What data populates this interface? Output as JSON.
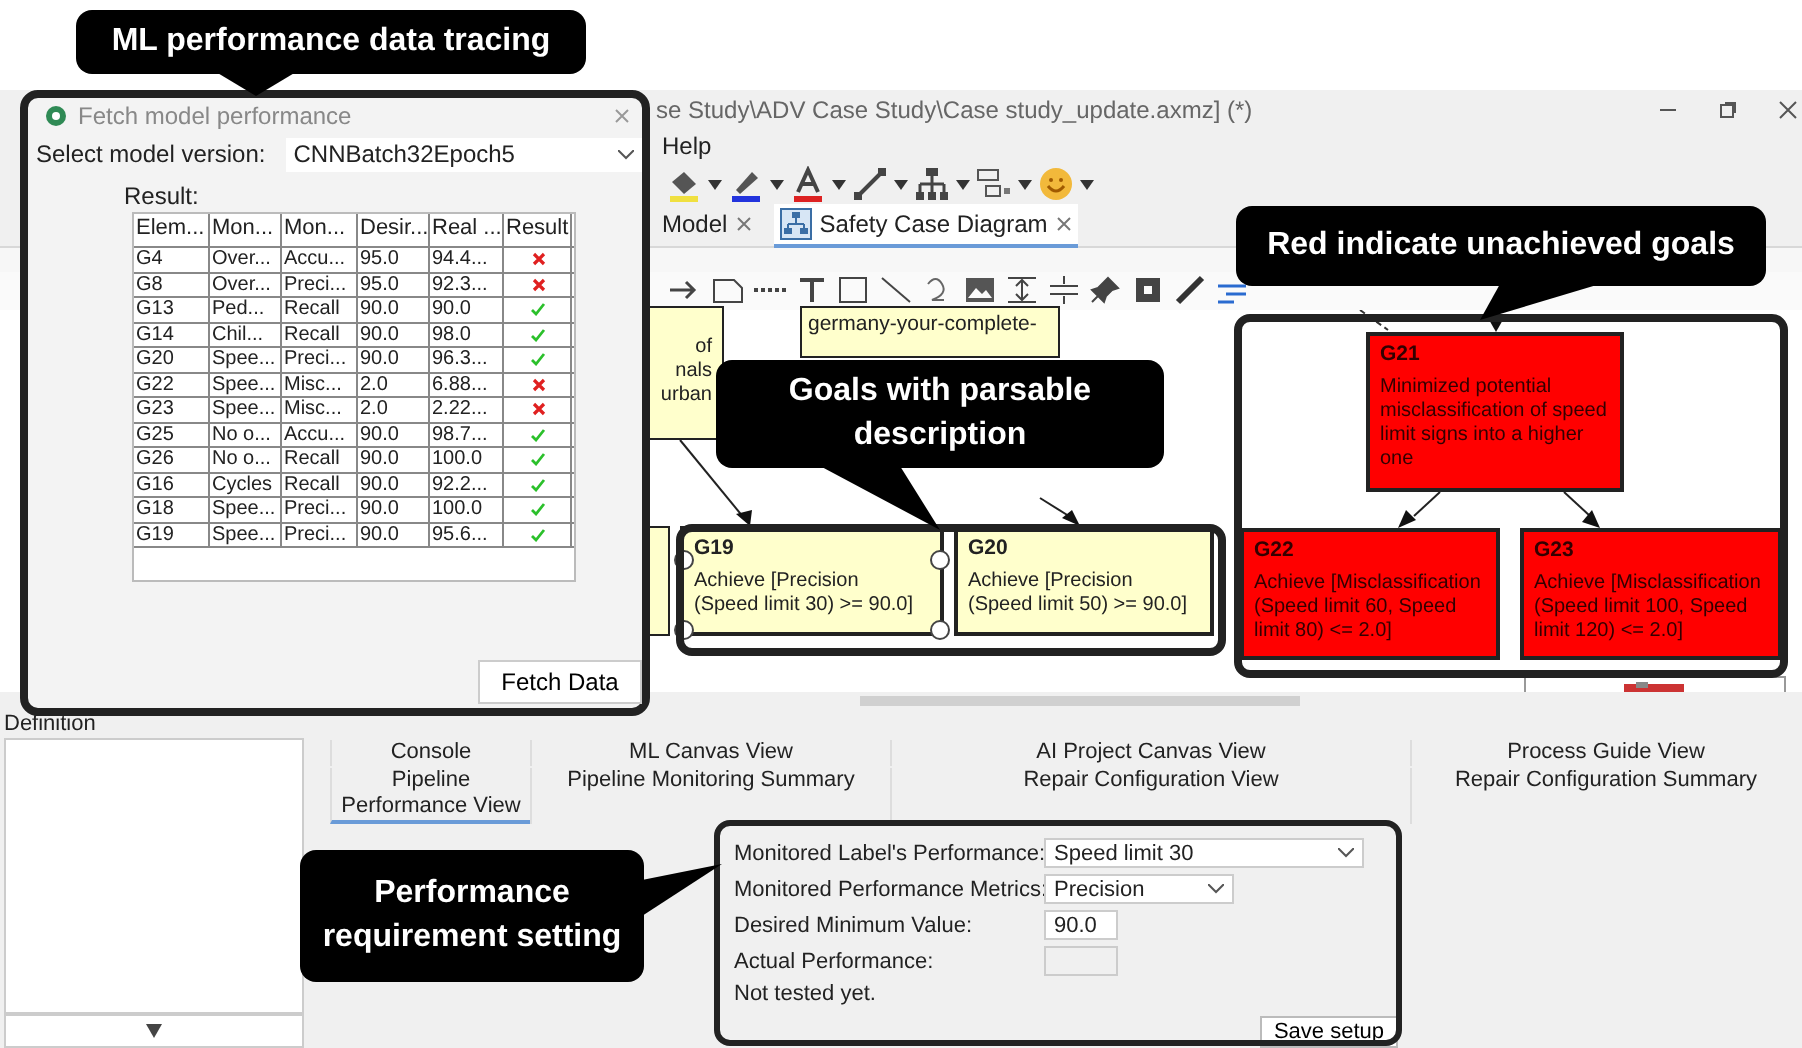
{
  "window": {
    "title": "se Study\\ADV Case Study\\Case study_update.axmz] (*)",
    "menu": [
      "Help"
    ]
  },
  "editor_tabs": [
    {
      "label": "Model",
      "selected": false
    },
    {
      "label": "Safety Case Diagram",
      "selected": true
    }
  ],
  "diagram_nodes": [
    {
      "kind": "fragment",
      "lines": [
        "of",
        "nals",
        "urban"
      ],
      "achieved": true,
      "selected": false
    },
    {
      "kind": "note",
      "lines": [
        "germany-your-complete-"
      ],
      "achieved": true,
      "selected": false
    },
    {
      "kind": "fragment",
      "achieved": true,
      "selected": false
    },
    {
      "kind": "goal",
      "title": "G19",
      "lines": [
        "Achieve  [Precision",
        "(Speed limit 30) >= 90.0]"
      ],
      "achieved": true,
      "selected": true
    },
    {
      "kind": "goal",
      "title": "G20",
      "lines": [
        "Achieve  [Precision",
        "(Speed limit 50) >= 90.0]"
      ],
      "achieved": true,
      "selected": false
    },
    {
      "kind": "goal",
      "title": "G21",
      "lines": [
        "Minimized potential misclassification of speed limit signs into a higher one"
      ],
      "achieved": false,
      "selected": false
    },
    {
      "kind": "goal",
      "title": "G22",
      "lines": [
        "Achieve  [Misclassification (Speed limit 60, Speed limit 80) <= 2.0]"
      ],
      "achieved": false,
      "selected": false
    },
    {
      "kind": "goal",
      "title": "G23",
      "lines": [
        "Achieve  [Misclassification (Speed limit 100, Speed limit 120) <= 2.0]"
      ],
      "achieved": false,
      "selected": false
    }
  ],
  "side_panel": {
    "label": "Definition"
  },
  "view_tabs": [
    {
      "label": "Console",
      "selected": false
    },
    {
      "label": "ML Canvas View",
      "selected": false
    },
    {
      "label": "AI Project Canvas View",
      "selected": false
    },
    {
      "label": "Process Guide View",
      "selected": false
    },
    {
      "label": "Pipeline Performance View",
      "selected": true
    },
    {
      "label": "Pipeline Monitoring Summary",
      "selected": false
    },
    {
      "label": "Repair Configuration View",
      "selected": false
    },
    {
      "label": "Repair Configuration Summary",
      "selected": false
    }
  ],
  "settings_form": {
    "fields": [
      {
        "kind": "select",
        "label": "Monitored Label's Performance:",
        "value": "Speed limit 30"
      },
      {
        "kind": "select",
        "label": "Monitored Performance Metrics:",
        "value": "Precision"
      },
      {
        "kind": "text",
        "label": "Desired Minimum Value:",
        "value": "90.0"
      },
      {
        "kind": "readonly",
        "label": "Actual Performance:"
      }
    ],
    "status": "Not tested yet.",
    "button": "Save setup"
  },
  "dialog": {
    "title": "Fetch model performance",
    "select_label": "Select model version:",
    "select_value": "CNNBatch32Epoch5",
    "result_label": "Result:",
    "columns": [
      "Elem...",
      "Mon...",
      "Mon...",
      "Desir...",
      "Real ...",
      "Result"
    ],
    "rows": [
      {
        "cells": [
          "G4",
          "Over...",
          "Accu...",
          "95.0",
          "94.4..."
        ],
        "achieved": false
      },
      {
        "cells": [
          "G8",
          "Over...",
          "Preci...",
          "95.0",
          "92.3..."
        ],
        "achieved": false
      },
      {
        "cells": [
          "G13",
          "Ped...",
          "Recall",
          "90.0",
          "90.0"
        ],
        "achieved": true
      },
      {
        "cells": [
          "G14",
          "Chil...",
          "Recall",
          "90.0",
          "98.0"
        ],
        "achieved": true
      },
      {
        "cells": [
          "G20",
          "Spee...",
          "Preci...",
          "90.0",
          "96.3..."
        ],
        "achieved": true
      },
      {
        "cells": [
          "G22",
          "Spee...",
          "Misc...",
          "2.0",
          "6.88..."
        ],
        "achieved": false
      },
      {
        "cells": [
          "G23",
          "Spee...",
          "Misc...",
          "2.0",
          "2.22..."
        ],
        "achieved": false
      },
      {
        "cells": [
          "G25",
          "No o...",
          "Accu...",
          "90.0",
          "98.7..."
        ],
        "achieved": true
      },
      {
        "cells": [
          "G26",
          "No o...",
          "Recall",
          "90.0",
          "100.0"
        ],
        "achieved": true
      },
      {
        "cells": [
          "G16",
          "Cycles",
          "Recall",
          "90.0",
          "92.2..."
        ],
        "achieved": true
      },
      {
        "cells": [
          "G18",
          "Spee...",
          "Preci...",
          "90.0",
          "100.0"
        ],
        "achieved": true
      },
      {
        "cells": [
          "G19",
          "Spee...",
          "Preci...",
          "90.0",
          "95.6..."
        ],
        "achieved": true
      }
    ],
    "button": "Fetch Data"
  },
  "callouts": [
    {
      "text": "ML performance data tracing"
    },
    {
      "text": "Red indicate unachieved goals"
    },
    {
      "text": "Goals with parsable description"
    },
    {
      "text": "Performance requirement setting"
    }
  ]
}
